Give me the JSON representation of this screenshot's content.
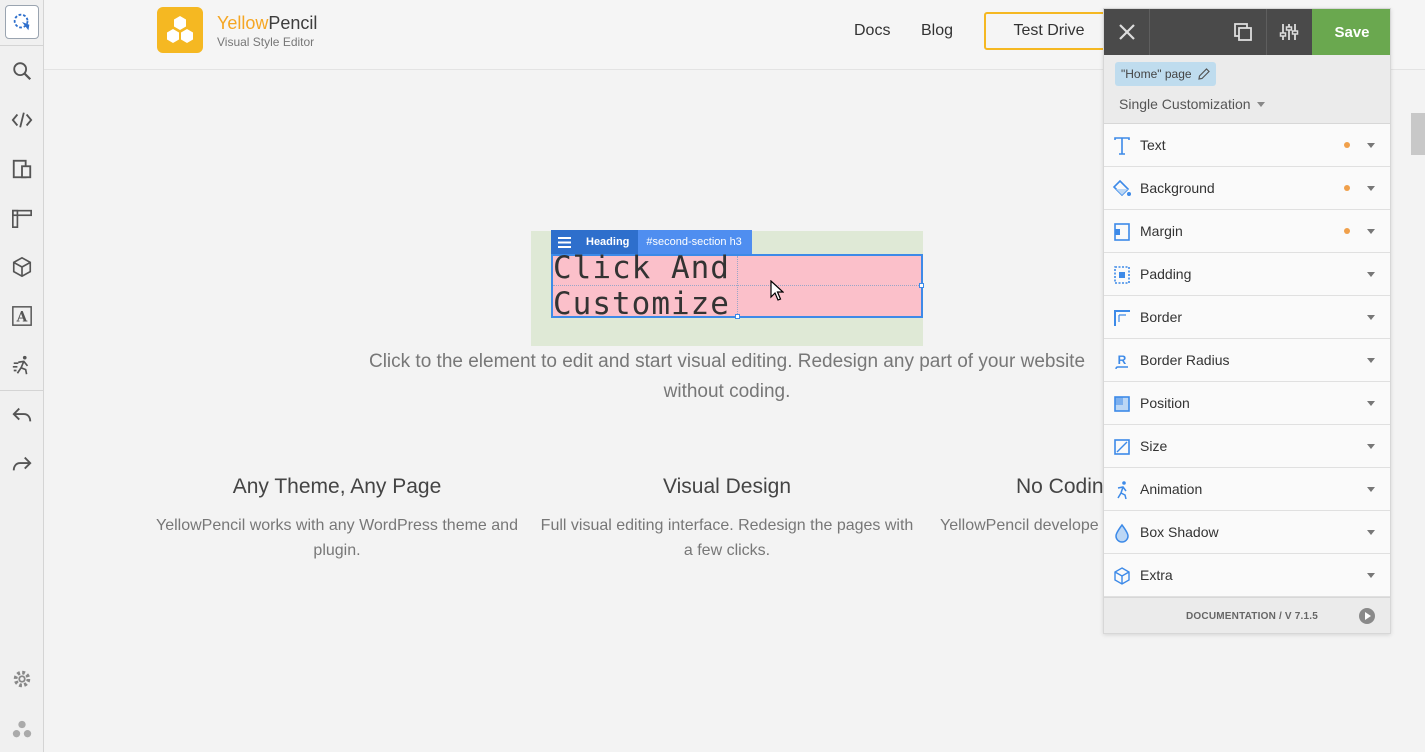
{
  "header": {
    "logo_title_yellow": "Yellow",
    "logo_title_rest": "Pencil",
    "logo_subtitle": "Visual Style Editor",
    "nav": [
      "Docs",
      "Blog"
    ],
    "test_drive_label": "Test Drive"
  },
  "selection": {
    "menu_icon": "hamburger-icon",
    "element_name": "Heading",
    "selector": "#second-section h3",
    "heading_text": "Click And Customize"
  },
  "content": {
    "description": "Click to the element to edit and start visual editing. Redesign any part of your website without coding.",
    "features": [
      {
        "title": "Any Theme, Any Page",
        "text": "YellowPencil works with any WordPress theme and plugin."
      },
      {
        "title": "Visual Design",
        "text": "Full visual editing interface. Redesign the pages with a few clicks."
      },
      {
        "title": "No Codin",
        "text": "YellowPencil develope for ev"
      }
    ]
  },
  "left_toolbar": {
    "tools": [
      "selector-icon",
      "search-icon",
      "code-icon",
      "responsive-icon",
      "ruler-icon",
      "3d-box-icon",
      "font-icon",
      "animation-icon",
      "undo-icon",
      "redo-icon"
    ],
    "bottom": [
      "settings-icon",
      "logo-icon"
    ]
  },
  "panel": {
    "close_icon": "close-icon",
    "save_label": "Save",
    "page_badge": "\"Home\" page",
    "mode_label": "Single Customization",
    "sections": [
      {
        "label": "Text",
        "icon": "text-icon",
        "modified": true
      },
      {
        "label": "Background",
        "icon": "paint-bucket-icon",
        "modified": true
      },
      {
        "label": "Margin",
        "icon": "margin-icon",
        "modified": true
      },
      {
        "label": "Padding",
        "icon": "padding-icon",
        "modified": false
      },
      {
        "label": "Border",
        "icon": "border-icon",
        "modified": false
      },
      {
        "label": "Border Radius",
        "icon": "border-radius-icon",
        "modified": false
      },
      {
        "label": "Position",
        "icon": "position-icon",
        "modified": false
      },
      {
        "label": "Size",
        "icon": "size-icon",
        "modified": false
      },
      {
        "label": "Animation",
        "icon": "animation-icon",
        "modified": false
      },
      {
        "label": "Box Shadow",
        "icon": "drop-icon",
        "modified": false
      },
      {
        "label": "Extra",
        "icon": "cube-icon",
        "modified": false
      }
    ],
    "footer_link": "DOCUMENTATION / V 7.1.5"
  },
  "colors": {
    "accent": "#f5b822",
    "selection_blue": "#3d8ae8",
    "save_green": "#6aa84f",
    "modified_dot": "#f0a04b"
  }
}
